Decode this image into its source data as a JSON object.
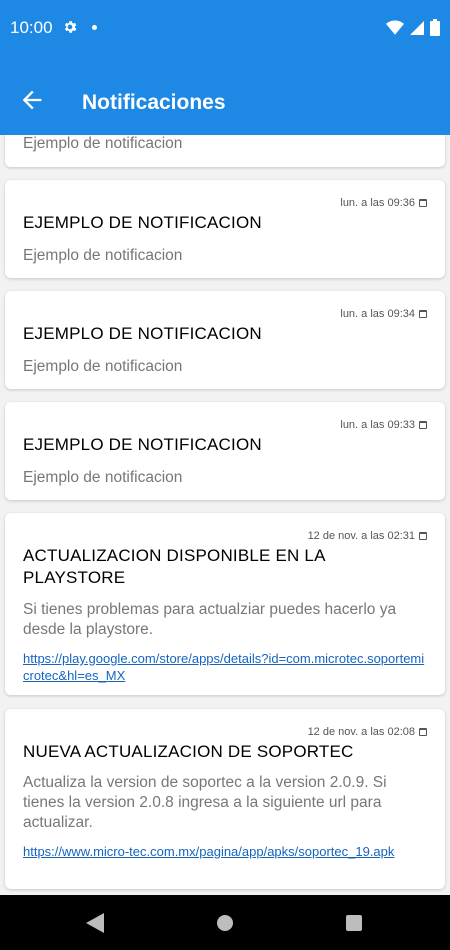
{
  "status": {
    "time": "10:00"
  },
  "header": {
    "title": "Notificaciones"
  },
  "notifications": [
    {
      "body": "Ejemplo de notificacion"
    },
    {
      "date": "lun. a las 09:36",
      "title": "EJEMPLO DE NOTIFICACION",
      "body": "Ejemplo de notificacion"
    },
    {
      "date": "lun. a las 09:34",
      "title": "EJEMPLO DE NOTIFICACION",
      "body": "Ejemplo de notificacion"
    },
    {
      "date": "lun. a las 09:33",
      "title": "EJEMPLO DE NOTIFICACION",
      "body": "Ejemplo de notificacion"
    },
    {
      "date": "12 de nov. a las 02:31",
      "title": "ACTUALIZACION DISPONIBLE EN LA PLAYSTORE",
      "body": "Si tienes problemas para actualziar puedes hacerlo ya desde la playstore.",
      "link": "https://play.google.com/store/apps/details?id=com.microtec.soportemicrotec&hl=es_MX"
    },
    {
      "date": "12 de nov. a las 02:08",
      "title": "NUEVA ACTUALIZACION DE SOPORTEC",
      "body": "Actualiza la version de soportec a la version 2.0.9. Si tienes la version 2.0.8  ingresa a la siguiente url  para actualizar.",
      "link": "https://www.micro-tec.com.mx/pagina/app/apks/soportec_19.apk"
    }
  ]
}
